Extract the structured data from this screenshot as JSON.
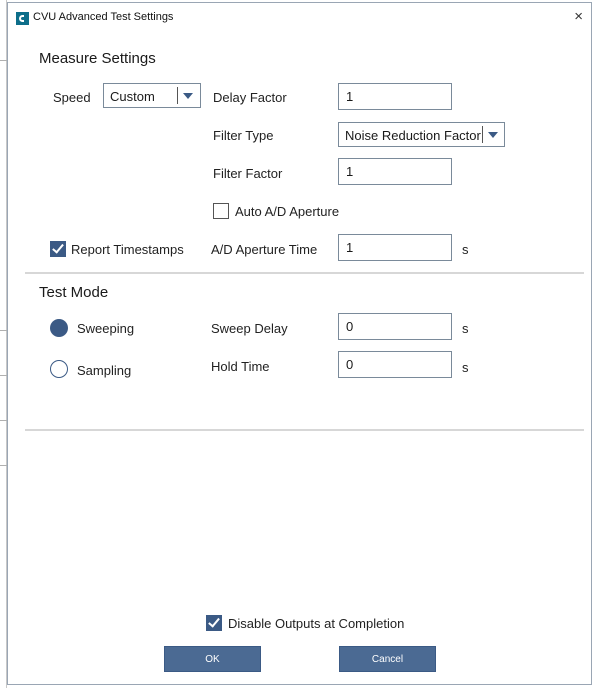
{
  "window": {
    "title": "CVU Advanced Test Settings",
    "close_glyph": "×"
  },
  "measure": {
    "title": "Measure Settings",
    "speed_label": "Speed",
    "speed_value": "Custom",
    "delay_factor_label": "Delay Factor",
    "delay_factor_value": "1",
    "filter_type_label": "Filter Type",
    "filter_type_value": "Noise Reduction Factor",
    "filter_factor_label": "Filter Factor",
    "filter_factor_value": "1",
    "auto_ad_label": "Auto A/D Aperture",
    "auto_ad_checked": false,
    "report_timestamps_label": "Report Timestamps",
    "report_timestamps_checked": true,
    "ad_aperture_label": "A/D Aperture Time",
    "ad_aperture_value": "1",
    "ad_aperture_unit": "s"
  },
  "test_mode": {
    "title": "Test Mode",
    "sweeping_label": "Sweeping",
    "sweeping_selected": true,
    "sampling_label": "Sampling",
    "sampling_selected": false,
    "sweep_delay_label": "Sweep Delay",
    "sweep_delay_value": "0",
    "sweep_delay_unit": "s",
    "hold_time_label": "Hold Time",
    "hold_time_value": "0",
    "hold_time_unit": "s"
  },
  "footer": {
    "disable_outputs_label": "Disable Outputs at Completion",
    "disable_outputs_checked": true,
    "ok_label": "OK",
    "cancel_label": "Cancel"
  },
  "colors": {
    "accent": "#3b5a85",
    "button": "#4b6a93",
    "divider": "#d7d7d7"
  }
}
